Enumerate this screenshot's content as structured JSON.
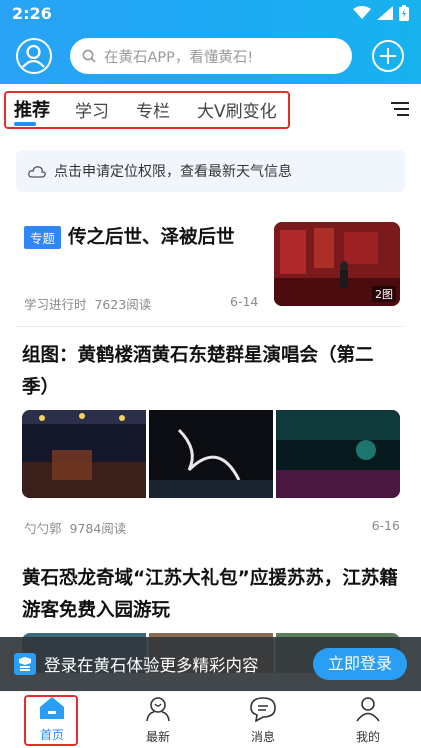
{
  "status": {
    "time": "2:26"
  },
  "search": {
    "placeholder": "在黄石APP，看懂黄石!"
  },
  "tabs": [
    {
      "label": "推荐",
      "active": true
    },
    {
      "label": "学习",
      "active": false
    },
    {
      "label": "专栏",
      "active": false
    },
    {
      "label": "大V刷变化",
      "active": false
    }
  ],
  "weather": {
    "text": "点击申请定位权限，查看最新天气信息"
  },
  "articles": [
    {
      "badge": "专题",
      "title": "传之后世、泽被后世",
      "source": "学习进行时",
      "reads": "7623阅读",
      "date": "6-14",
      "img_count": "2图"
    },
    {
      "title": "组图：黄鹤楼酒黄石东楚群星演唱会（第二季）",
      "source": "勺勺郭",
      "reads": "9784阅读",
      "date": "6-16"
    },
    {
      "title": "黄石恐龙奇域“江苏大礼包”应援苏苏，江苏籍游客免费入园游玩"
    }
  ],
  "login_bar": {
    "text": "登录在黄石体验更多精彩内容",
    "button": "立即登录"
  },
  "bottom_nav": [
    {
      "label": "首页",
      "icon": "home-icon",
      "active": true
    },
    {
      "label": "最新",
      "icon": "newest-icon",
      "active": false
    },
    {
      "label": "消息",
      "icon": "message-icon",
      "active": false
    },
    {
      "label": "我的",
      "icon": "profile-icon",
      "active": false
    }
  ],
  "colors": {
    "accent": "#1e90ff",
    "header": "#1ea7f4",
    "highlight": "#e0302d"
  }
}
